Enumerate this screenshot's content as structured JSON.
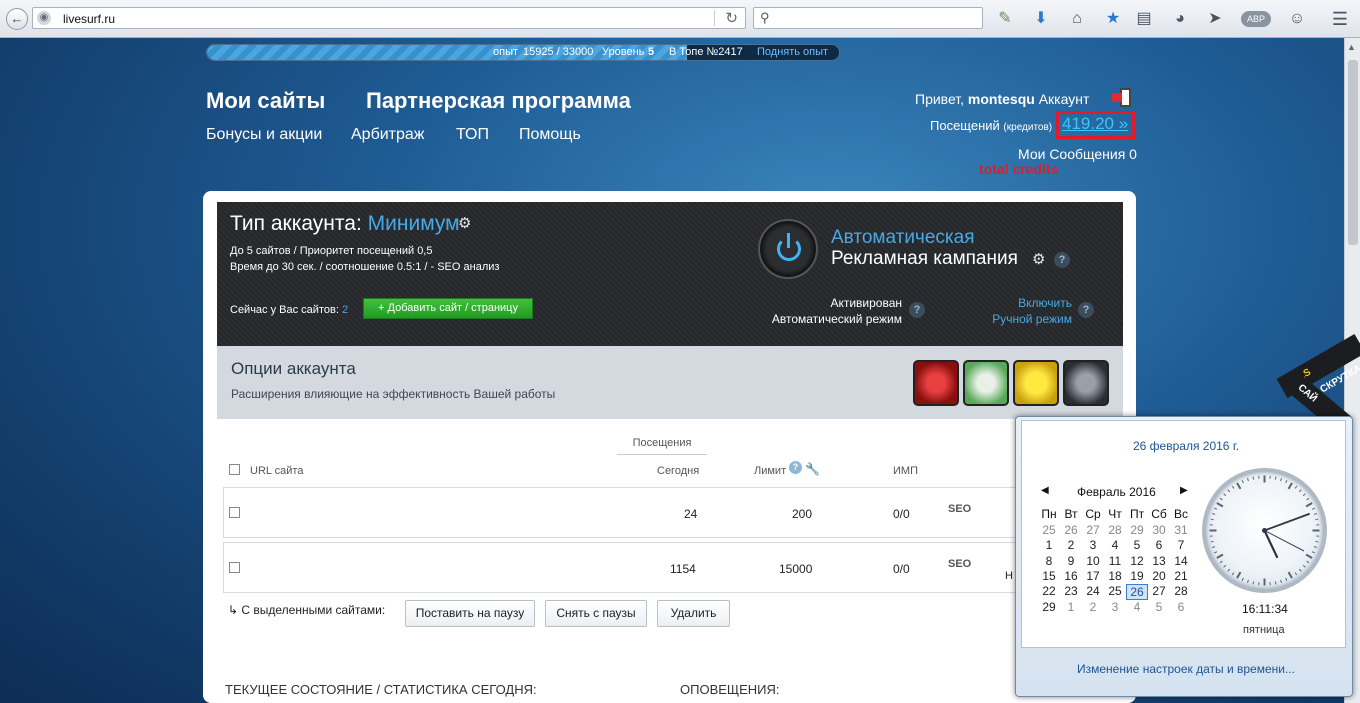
{
  "browser": {
    "url": "livesurf.ru",
    "search_placeholder": "",
    "toolbar_icons": [
      "puzzle-icon",
      "download-icon",
      "home-icon",
      "star-icon",
      "bookmarks-icon",
      "pocket-icon",
      "send-icon",
      "abp-icon",
      "chat-icon",
      "menu-icon"
    ],
    "abp_label": "ABP"
  },
  "xp": {
    "label": "опыт",
    "value": "15925 / 33000",
    "level_label": "Уровень",
    "level": "5",
    "top_label": "В Топе №2417",
    "raise_link": "Поднять опыт",
    "progress": 0.48
  },
  "nav": {
    "main": [
      "Мои сайты",
      "Партнерская программа"
    ],
    "sub": [
      "Бонусы и акции",
      "Арбитраж",
      "ТОП",
      "Помощь"
    ]
  },
  "user": {
    "greeting": "Привет,",
    "name": "montesqu",
    "account": "Аккаунт",
    "visits_label": "Посещений",
    "credits_label": "(кредитов)",
    "credits": "419.20",
    "credits_arrow": "»",
    "messages": "Мои Сообщения 0",
    "annotation": "total credits"
  },
  "account": {
    "type_label": "Тип аккаунта:",
    "level": "Минимум",
    "desc1": "До 5 сайтов / Приоритет посещений 0,5",
    "desc2": "Время до 30 сек. / соотношение 0.5:1 / - SEO анализ",
    "sites_now": "Сейчас у Вас сайтов:",
    "sites_count": "2",
    "add_button": "Добавить сайт / страницу",
    "auto1": "Автоматическая",
    "auto2": "Рекламная кампания",
    "status1a": "Активирован",
    "status1b": "Автоматический режим",
    "status2a": "Включить",
    "status2b": "Ручной режим"
  },
  "options": {
    "title": "Опции аккаунта",
    "subtitle": "Расширения влияющие на эффективность Вашей работы",
    "icons": [
      "rocket-icon",
      "megaphone-icon",
      "chick-icon",
      "agent-icon"
    ]
  },
  "table": {
    "visits_header": "Посещения",
    "col_url": "URL сайта",
    "col_today": "Сегодня",
    "col_limit": "Лимит",
    "col_imp": "ИМП",
    "rows": [
      {
        "today": "24",
        "limit": "200",
        "imp": "0/0",
        "seo": "SEO"
      },
      {
        "today": "1154",
        "limit": "15000",
        "imp": "0/0",
        "seo": "SEO"
      }
    ],
    "row2_trailing": "Н",
    "selected_label": "С выделенными сайтами:",
    "btn_pause": "Поставить на паузу",
    "btn_unpause": "Снять с паузы",
    "btn_delete": "Удалить"
  },
  "bottom": {
    "stats": "ТЕКУЩЕЕ СОСТОЯНИЕ / СТАТИСТИКА СЕГОДНЯ:",
    "alerts": "ОПОВЕЩЕНИЯ:"
  },
  "ribbon": {
    "ls": "LS",
    "text1": "РАСКРУТКА",
    "text2": "САЙ"
  },
  "calendar": {
    "date_title": "26 февраля 2016 г.",
    "month": "Февраль 2016",
    "dow": [
      "Пн",
      "Вт",
      "Ср",
      "Чт",
      "Пт",
      "Сб",
      "Вс"
    ],
    "weeks": [
      [
        "25",
        "26",
        "27",
        "28",
        "29",
        "30",
        "31"
      ],
      [
        "1",
        "2",
        "3",
        "4",
        "5",
        "6",
        "7"
      ],
      [
        "8",
        "9",
        "10",
        "11",
        "12",
        "13",
        "14"
      ],
      [
        "15",
        "16",
        "17",
        "18",
        "19",
        "20",
        "21"
      ],
      [
        "22",
        "23",
        "24",
        "25",
        "26",
        "27",
        "28"
      ],
      [
        "29",
        "1",
        "2",
        "3",
        "4",
        "5",
        "6"
      ]
    ],
    "today": "26",
    "time": "16:11:34",
    "weekday": "пятница",
    "settings_link": "Изменение настроек даты и времени..."
  }
}
